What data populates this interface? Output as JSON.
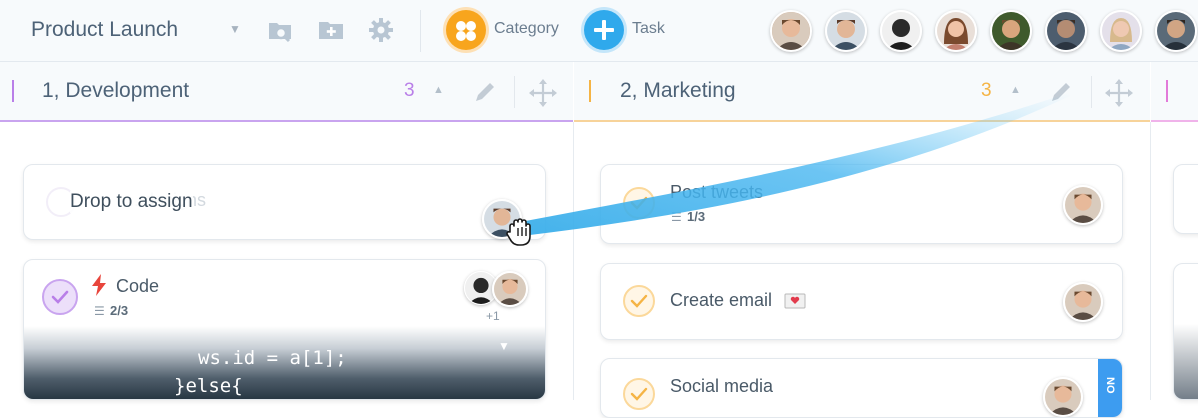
{
  "project": {
    "title": "Product Launch"
  },
  "toolbar": {
    "category_label": "Category",
    "task_label": "Task"
  },
  "columns": [
    {
      "title": "1, Development",
      "count": "3",
      "color": "#b97fe8"
    },
    {
      "title": "2, Marketing",
      "count": "3",
      "color": "#f5b445"
    },
    {
      "color": "#e27ad9"
    }
  ],
  "drop_card": {
    "ghost_text": "... designs",
    "hint": "Drop to assign"
  },
  "code_card": {
    "title": "Code",
    "subtasks": "2/3",
    "extra_assignees": "+1",
    "code_lines": [
      "ws.id = a[1];",
      "}else{"
    ]
  },
  "marketing_cards": [
    {
      "title": "Post tweets",
      "subtasks": "1/3"
    },
    {
      "title": "Create email"
    },
    {
      "title": "Social media",
      "badge": "NO"
    }
  ],
  "colors": {
    "accent_blue": "#2fa9ec",
    "accent_orange": "#f8a51d",
    "text": "#4d6277"
  }
}
